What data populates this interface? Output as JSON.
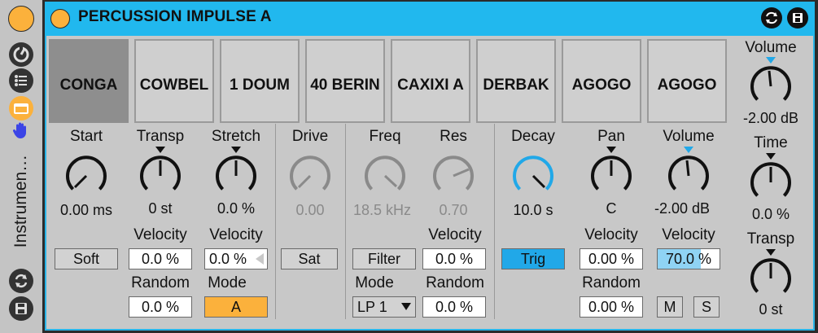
{
  "strip": {
    "label": "Instrumen…",
    "icons": [
      "hotswap-icon",
      "list-icon",
      "device-view-icon",
      "hand-icon",
      "refresh-icon",
      "save-icon"
    ]
  },
  "device": {
    "title": "PERCUSSION IMPULSE A",
    "colors": {
      "accent": "#21b8ee",
      "fold": "#fbb13c",
      "selected_slot": "#8e8e8e",
      "trig_on": "#21a8e8",
      "mode_on": "#fbb13c"
    }
  },
  "slots": [
    "CONGA",
    "COWBEL",
    "1 DOUM",
    "40 BERIN",
    "CAXIXI A",
    "DERBAK",
    "AGOGO",
    "AGOGO"
  ],
  "selected_slot": 0,
  "sample": {
    "start_label": "Start",
    "start_value": "0.00 ms",
    "soft_label": "Soft",
    "transp_label": "Transp",
    "transp_value": "0 st",
    "transp_velocity_label": "Velocity",
    "transp_velocity_value": "0.0 %",
    "transp_random_label": "Random",
    "transp_random_value": "0.0 %",
    "stretch_label": "Stretch",
    "stretch_value": "0.0 %",
    "stretch_velocity_label": "Velocity",
    "stretch_velocity_value": "0.0 %",
    "mode_label": "Mode",
    "mode_value": "A"
  },
  "saturator": {
    "drive_label": "Drive",
    "drive_value": "0.00",
    "sat_label": "Sat"
  },
  "filter": {
    "freq_label": "Freq",
    "freq_value": "18.5 kHz",
    "res_label": "Res",
    "res_value": "0.70",
    "filter_button": "Filter",
    "mode_label": "Mode",
    "mode_value": "LP 1",
    "res_velocity_label": "Velocity",
    "res_velocity_value": "0.0 %",
    "res_random_label": "Random",
    "res_random_value": "0.0 %"
  },
  "envelope": {
    "decay_label": "Decay",
    "decay_value": "10.0 s",
    "trig_label": "Trig"
  },
  "pan": {
    "pan_label": "Pan",
    "pan_value": "C",
    "velocity_label": "Velocity",
    "velocity_value": "0.00 %",
    "random_label": "Random",
    "random_value": "0.00 %"
  },
  "slot_volume": {
    "volume_label": "Volume",
    "volume_value": "-2.00 dB",
    "velocity_label": "Velocity",
    "velocity_value": "70.0 %",
    "velocity_fraction": 0.7,
    "mute_label": "M",
    "solo_label": "S"
  },
  "global": {
    "volume_label": "Volume",
    "volume_value": "-2.00 dB",
    "time_label": "Time",
    "time_value": "0.0 %",
    "transp_label": "Transp",
    "transp_value": "0 st"
  }
}
